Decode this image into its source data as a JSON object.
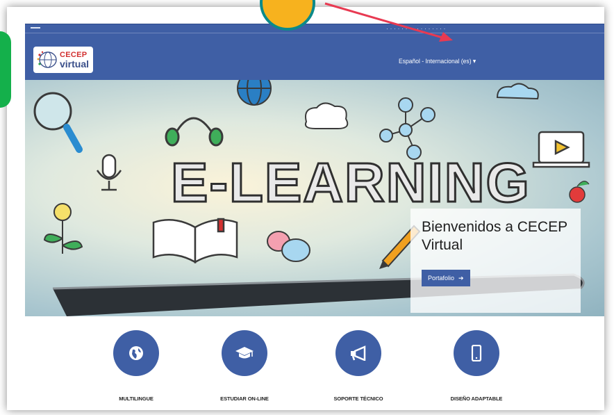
{
  "topbar": {
    "hint_text": "· · · · · · · · · · · · · · · ·",
    "language": "Español - Internacional (es)",
    "chevron_icon": "caret-down-icon"
  },
  "logo": {
    "line1": "CECEP",
    "line2": "virtual"
  },
  "hero": {
    "headline": "E-LEARNING",
    "welcome_title": "Bienvenidos a CECEP Virtual",
    "portfolio_button": "Portafolio",
    "portfolio_icon": "arrow-right-icon"
  },
  "features": [
    {
      "label": "MULTILINGUE",
      "icon": "globe-icon"
    },
    {
      "label": "ESTUDIAR ON-LINE",
      "icon": "graduation-cap-icon"
    },
    {
      "label": "SOPORTE TÉCNICO",
      "icon": "megaphone-icon"
    },
    {
      "label": "DISEÑO ADAPTABLE",
      "icon": "mobile-phone-icon"
    }
  ],
  "colors": {
    "brand_blue": "#3f5fa5",
    "badge_yellow": "#f7b21e",
    "tab_green": "#14b04b",
    "arrow_red": "#e83a52"
  }
}
